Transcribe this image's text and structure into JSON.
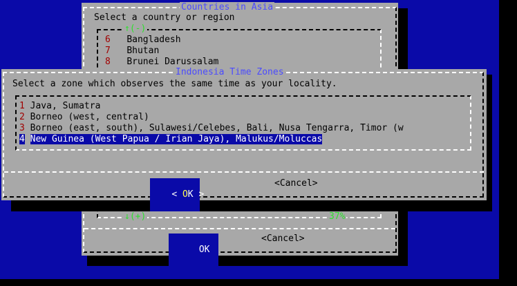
{
  "outer_dialog": {
    "title": "Countries in Asia",
    "prompt": "Select a country or region",
    "scroll_up": "↑(-)",
    "items": [
      {
        "num": "6",
        "label": "Bangladesh"
      },
      {
        "num": "7",
        "label": "Bhutan"
      },
      {
        "num": "8",
        "label": "Brunei Darussalam"
      }
    ],
    "scroll_down": "↓(+)",
    "percent": "37%",
    "ok_label": "OK",
    "cancel_label": "<Cancel>"
  },
  "inner_dialog": {
    "title": "Indonesia Time Zones",
    "prompt": "Select a zone which observes the same time as your locality.",
    "items": [
      {
        "num": "1",
        "label": "Java, Sumatra"
      },
      {
        "num": "2",
        "label": "Borneo (west, central)"
      },
      {
        "num": "3",
        "label": "Borneo (east, south), Sulawesi/Celebes, Bali, Nusa Tengarra, Timor (w"
      },
      {
        "num": "4",
        "label": "New Guinea (West Papua / Irian Jaya), Malukus/Moluccas"
      }
    ],
    "selected_index": 3,
    "ok_left": "<",
    "ok_hot": "O",
    "ok_rest": "K",
    "ok_right": ">",
    "cancel_label": "<Cancel>"
  },
  "colors": {
    "background": "#0a0aa8",
    "panel": "#a8a8a8",
    "title": "#4b4bff",
    "number": "#a00000",
    "highlight": "#0a0aa8"
  }
}
